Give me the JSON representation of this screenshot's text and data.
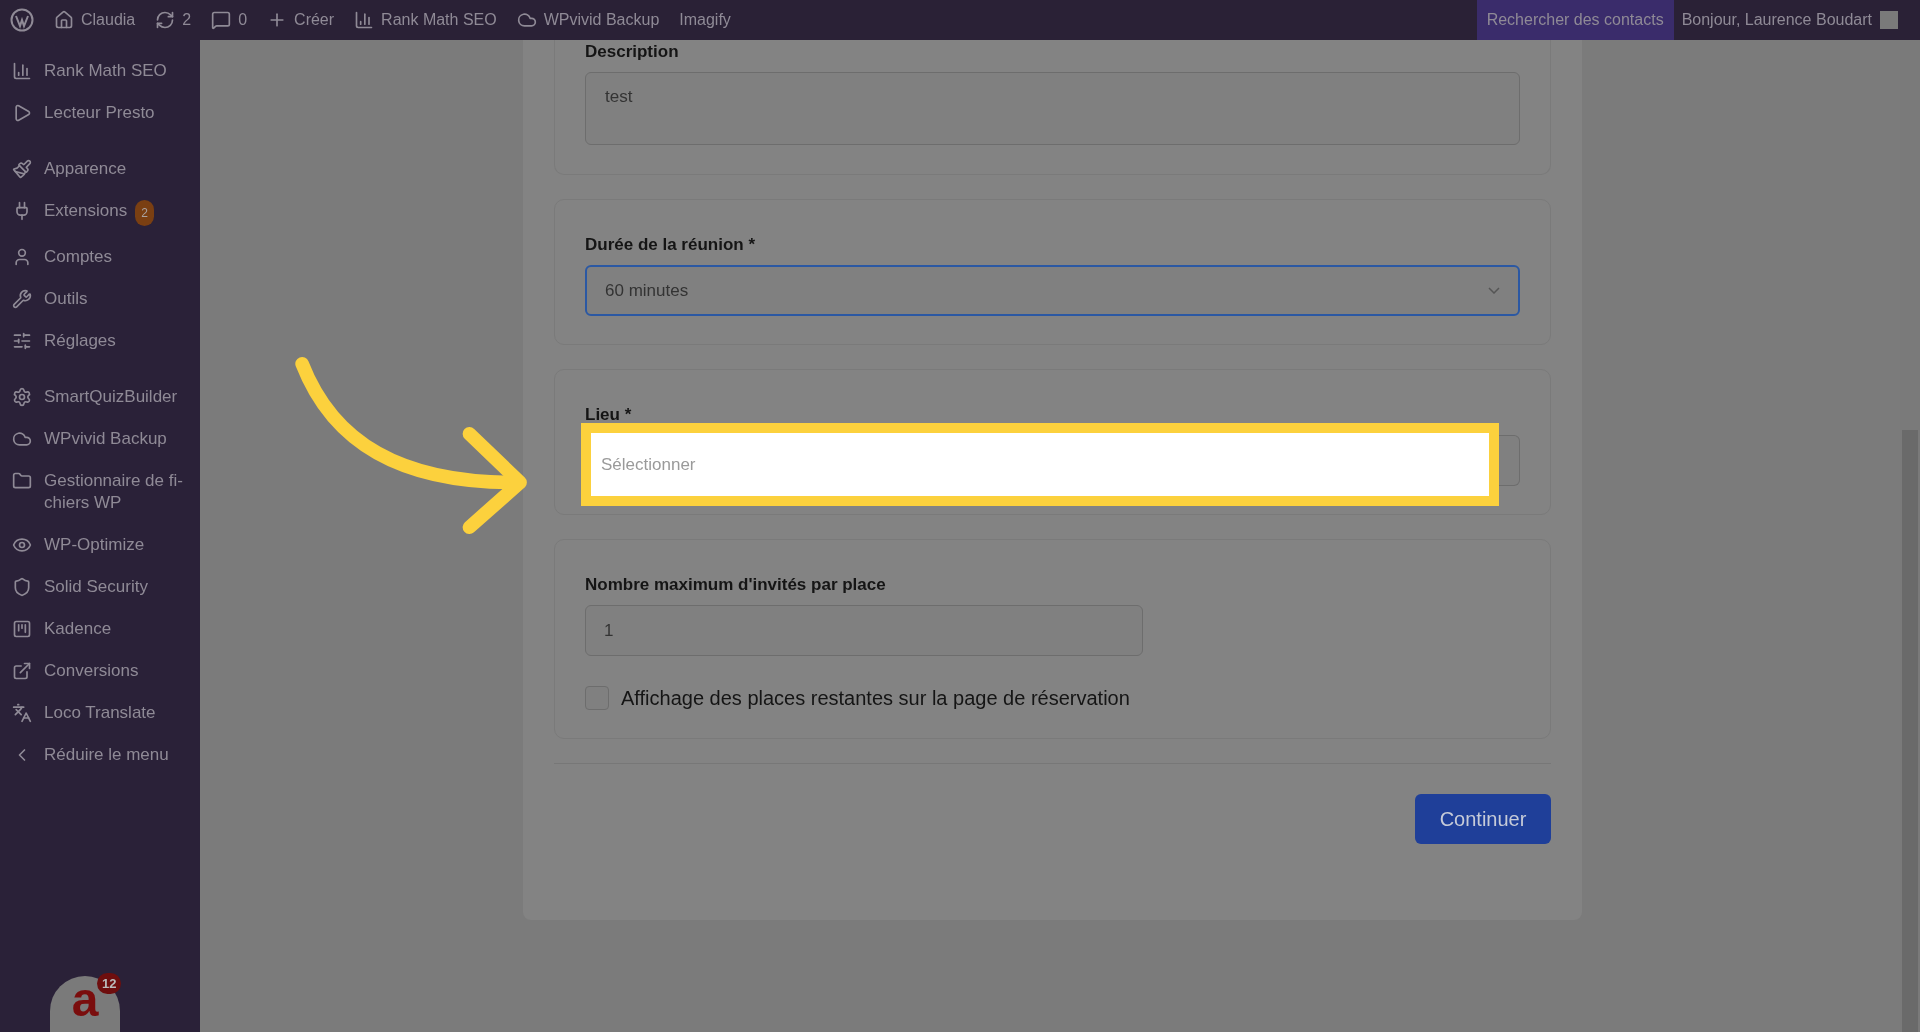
{
  "top_bar": {
    "site": "Claudia",
    "updates": "2",
    "comments": "0",
    "new": "Créer",
    "plugins": [
      "Rank Math SEO",
      "WPvivid Backup",
      "Imagify"
    ],
    "search_contacts": "Rechercher des contacts",
    "greeting": "Bonjour, Laurence Boudart"
  },
  "sidebar": {
    "groups": [
      [
        {
          "label": "Rank Math SEO"
        },
        {
          "label": "Lecteur Presto"
        }
      ],
      [
        {
          "label": "Apparence"
        },
        {
          "label": "Extensions",
          "badge": "2"
        },
        {
          "label": "Comptes"
        },
        {
          "label": "Outils"
        },
        {
          "label": "Réglages"
        }
      ],
      [
        {
          "label": "SmartQuizBuilder"
        },
        {
          "label": "WPvivid Backup"
        },
        {
          "label": "Gestionnaire de fi-chiers WP"
        },
        {
          "label": "WP-Optimize"
        },
        {
          "label": "Solid Security"
        },
        {
          "label": "Kadence"
        },
        {
          "label": "Conversions"
        },
        {
          "label": "Loco Translate"
        },
        {
          "label": "Réduire le menu"
        }
      ]
    ],
    "chat_logo": "a",
    "chat_badge": "12"
  },
  "form": {
    "description": {
      "label": "Description",
      "value": "test"
    },
    "duration": {
      "label": "Durée de la réunion *",
      "value": "60 minutes"
    },
    "location": {
      "label": "Lieu *",
      "placeholder": "Sélectionner",
      "highlighted": true
    },
    "max_guests": {
      "label": "Nombre maximum d'invités par place",
      "value": "1"
    },
    "show_remaining": {
      "label": "Affichage des places restantes sur la page de réservation",
      "checked": false
    },
    "continue_button": "Continuer"
  }
}
